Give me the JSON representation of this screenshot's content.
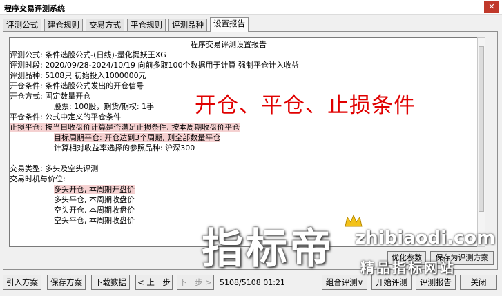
{
  "window": {
    "title": "程序交易评测系统",
    "close_label": "✕"
  },
  "tabs": [
    "评测公式",
    "建仓规则",
    "交易方式",
    "平仓规则",
    "评测品种",
    "设置报告"
  ],
  "active_tab": "设置报告",
  "report": {
    "heading": "程序交易评测设置报告",
    "lines": [
      "评测公式: 条件选股公式-(日线)-量化提妖王XG",
      "评测时段: 2020/09/28-2024/10/19 向前多取100个数据用于计算 强制平仓计入收益",
      "评测品种: 5108只 初始投入1000000元",
      "开仓条件: 条件选股公式发出的开仓信号",
      "开仓方式: 固定数量开仓",
      "股票: 100股，期货/期权: 1手",
      "平仓条件: 公式中定义的平仓条件",
      "止损平仓: 按当日收盘价计算是否满足止损条件, 按本周期收盘价平仓",
      "目标周期平仓: 开仓达到3个周期, 则全部数量平仓",
      "计算相对收益率选择的参照品种: 沪深300",
      "交易类型: 多头及空头评测",
      "交易时机与价位:",
      "多头开仓, 本周期开盘价",
      "多头平仓, 本周期收盘价",
      "空头开仓, 本周期收盘价",
      "空头平仓, 本周期收盘价"
    ]
  },
  "overlay_annotation": "开仓、平仓、止损条件",
  "panel_buttons": {
    "optimize": "优化参数",
    "save_settings": "保存为评测方案"
  },
  "bottom_buttons": {
    "import": "引入方案",
    "save": "保存方案",
    "download": "下载数据",
    "prev": "< 上一步",
    "next": "下一步 >",
    "combo": "组合评测∨",
    "start": "开始评测",
    "report": "评测报告",
    "close": "关闭"
  },
  "status_text": "5108/5108 01:21",
  "watermark": {
    "big": "指标帝",
    "url": "zhibiaodi.com",
    "sub": "精品指标网站"
  },
  "colors": {
    "annotation": "#e00000",
    "highlight": "#f5d1d1",
    "close": "#c0392b"
  }
}
